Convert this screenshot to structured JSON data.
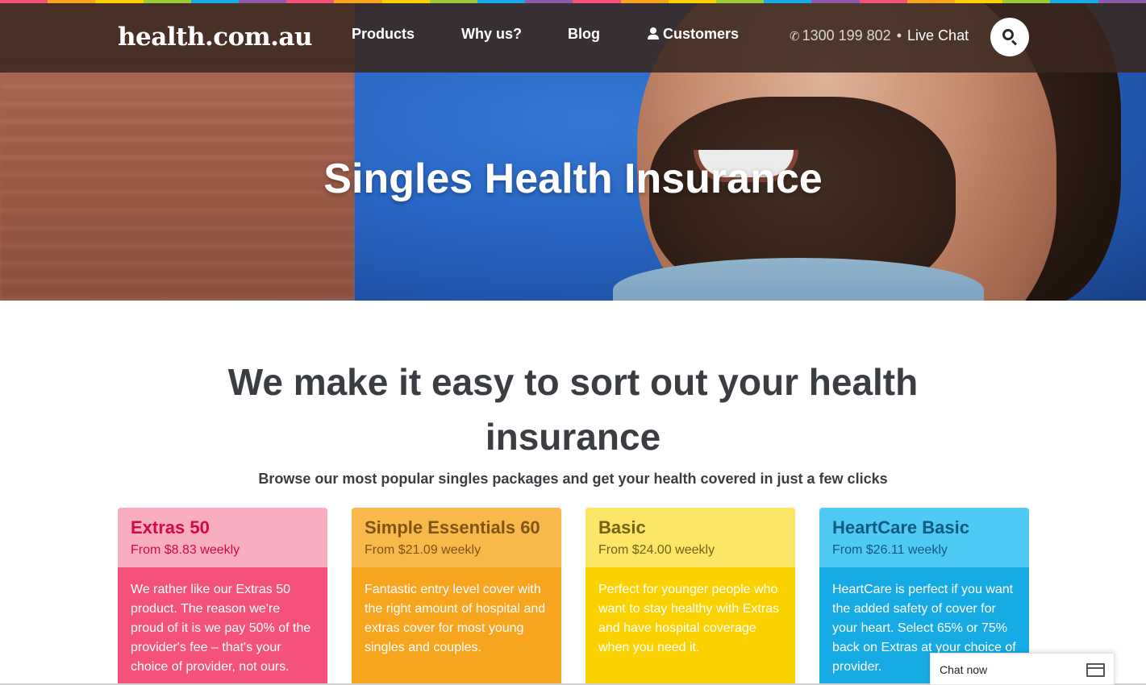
{
  "colors": {
    "rainbow": [
      "#f4527a",
      "#f7a41f",
      "#fbd200",
      "#9bcb3b",
      "#17abe6",
      "#8e5aa8"
    ],
    "nav_bg": "#3a2820",
    "text_dark": "#3a3d42"
  },
  "header": {
    "logo": "health.com.au",
    "nav": {
      "products": "Products",
      "why_us": "Why us?",
      "blog": "Blog",
      "customers": "Customers"
    },
    "phone": "1300 199 802",
    "separator": "•",
    "live_chat": "Live Chat",
    "icons": {
      "phone": "phone-icon",
      "user": "user-icon",
      "search": "search-icon"
    }
  },
  "hero": {
    "title": "Singles Health Insurance"
  },
  "main": {
    "heading": "We make it easy to sort out your health insurance",
    "subheading": "Browse our most popular singles packages and get your health covered in just a few clicks"
  },
  "cards": [
    {
      "name": "Extras 50",
      "price": "From $8.83 weekly",
      "description": "We rather like our Extras 50 product. The reason we're proud of it is we pay 50% of the provider's fee – that's your choice of provider, not ours."
    },
    {
      "name": "Simple Essentials 60",
      "price": "From $21.09 weekly",
      "description": "Fantastic entry level cover with the right amount of hospital and extras cover for most young singles and couples."
    },
    {
      "name": "Basic",
      "price": "From $24.00 weekly",
      "description": "Perfect for younger people who want to stay healthy with Extras and have hospital coverage when you need it."
    },
    {
      "name": "HeartCare Basic",
      "price": "From $26.11 weekly",
      "description": "HeartCare is perfect if you want the added safety of cover for your heart. Select 65% or 75% back on Extras at your choice of provider."
    }
  ],
  "chat_widget": {
    "label": "Chat now",
    "icon": "window-icon"
  }
}
